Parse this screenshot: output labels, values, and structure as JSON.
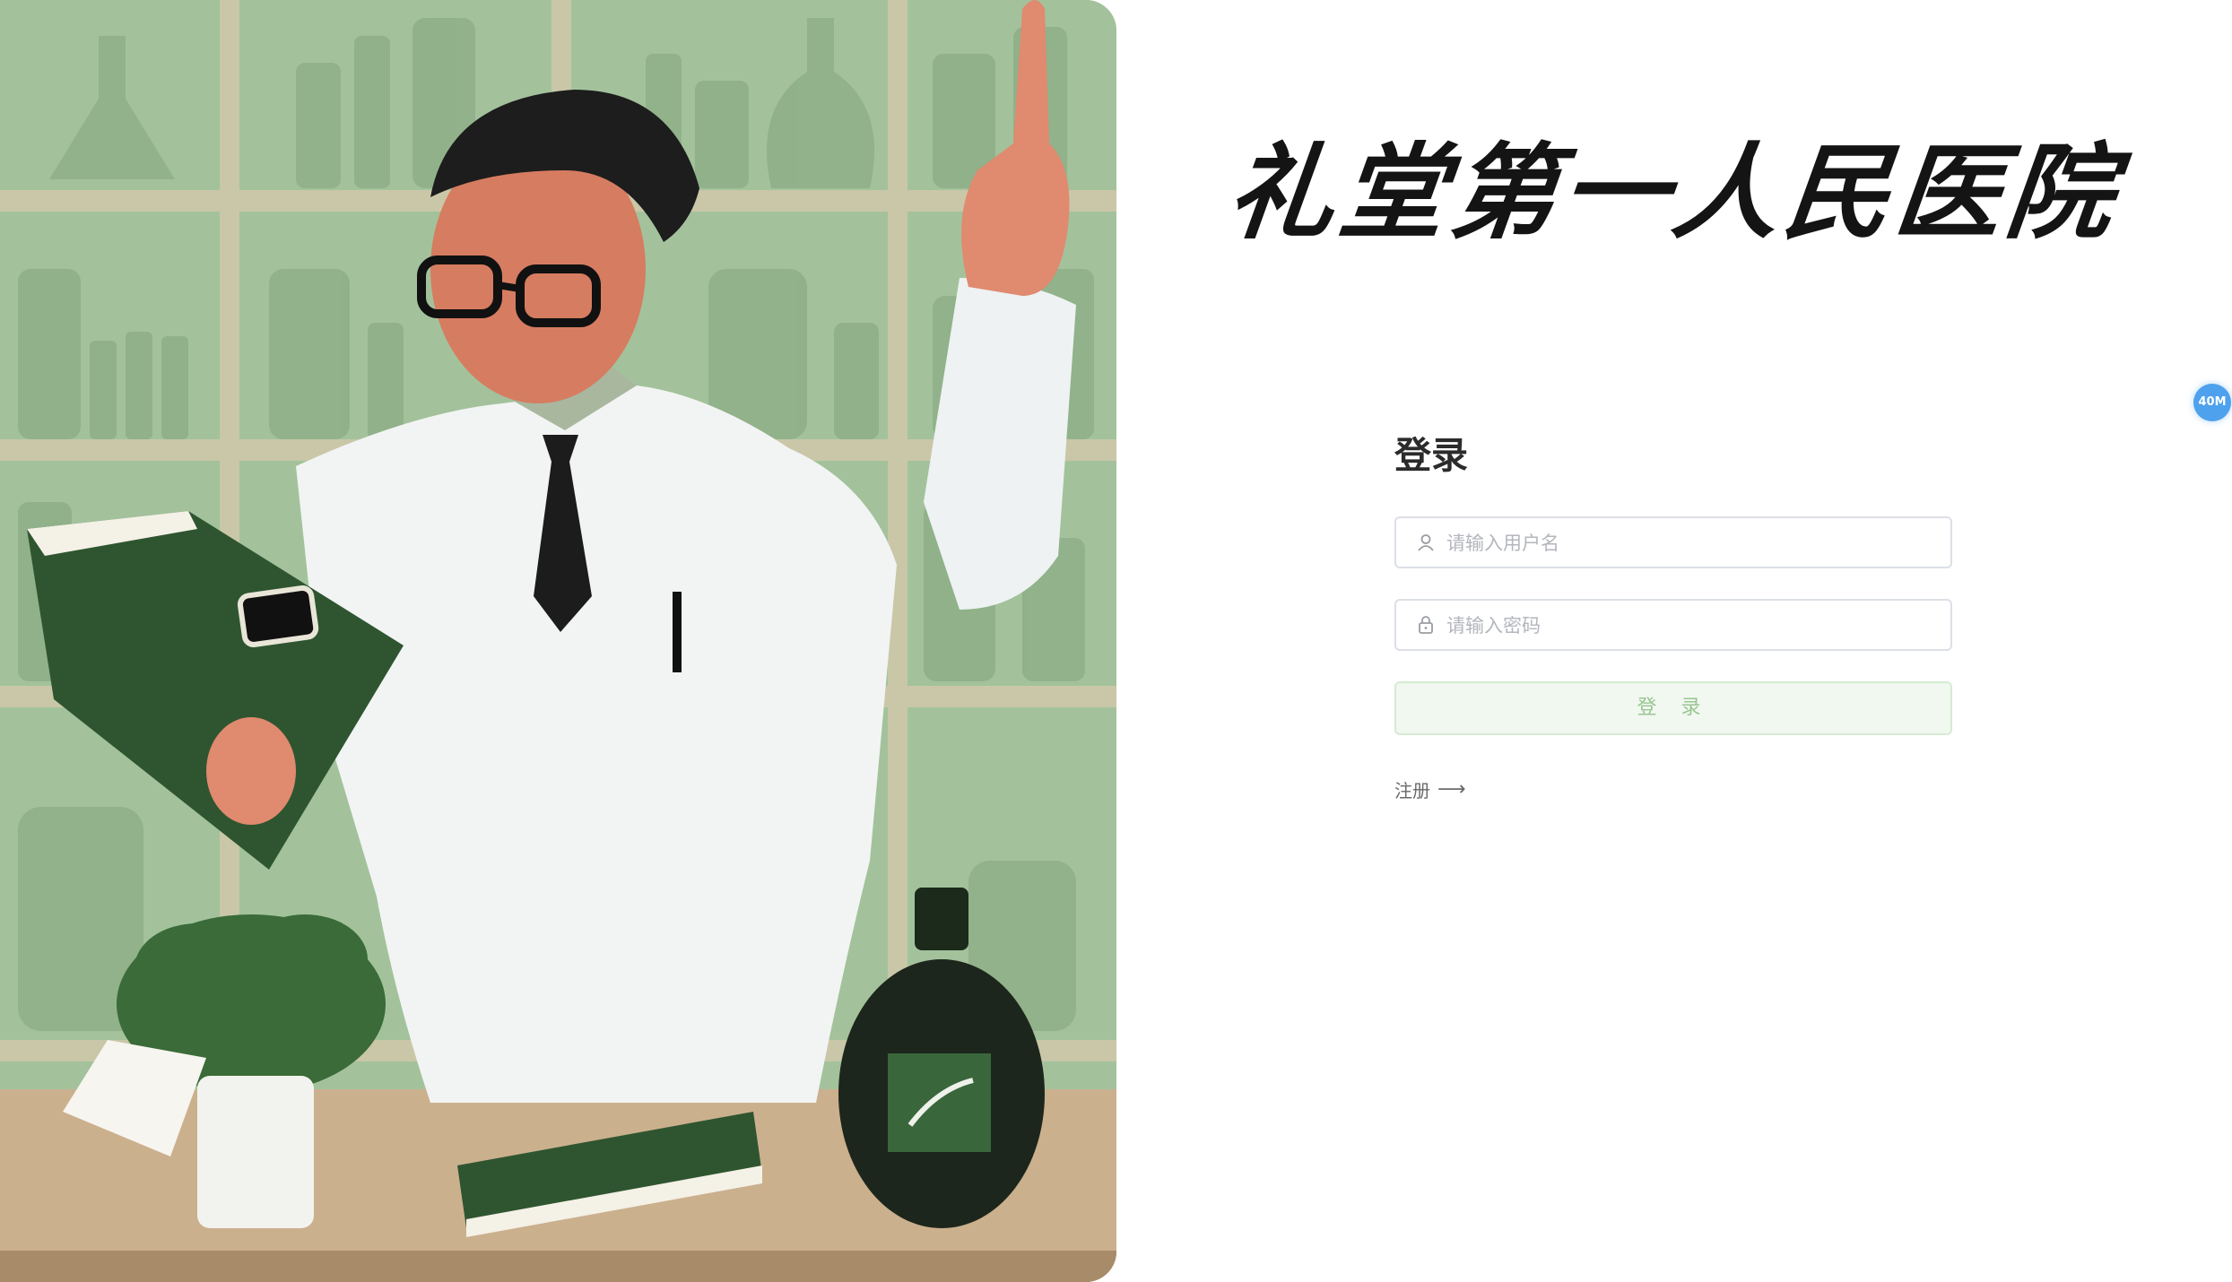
{
  "brand": {
    "title": "礼堂第一人民医院"
  },
  "login": {
    "heading": "登录",
    "username": {
      "placeholder": "请输入用户名",
      "value": "",
      "icon": "user-icon"
    },
    "password": {
      "placeholder": "请输入密码",
      "value": "",
      "icon": "lock-icon"
    },
    "submit_label": "登 录",
    "register_label": "注册",
    "register_icon": "arrow-right-icon"
  },
  "side_badge": {
    "label": "40M",
    "color": "#4ea1ec"
  },
  "colors": {
    "accent": "#9ac592",
    "button_bg": "#f1f8f0",
    "hero_background": "#9fbd98"
  }
}
